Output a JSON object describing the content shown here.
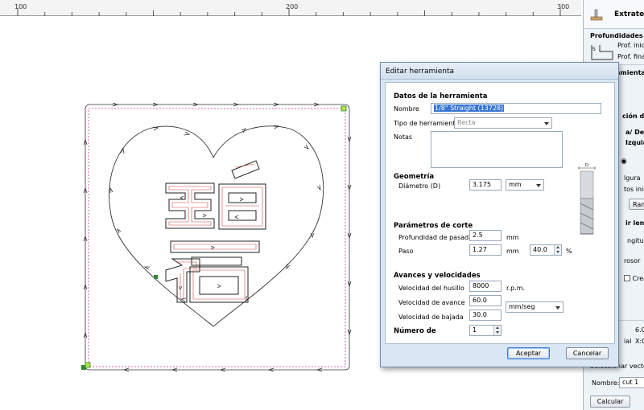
{
  "ruler": {
    "ticks": [
      "100",
      "200",
      "300"
    ]
  },
  "right_panel": {
    "title": "Extrategi",
    "depths_heading": "Profundidades de",
    "start_depth": "Prof. inicio",
    "final_depth": "Prof. final",
    "tool_label": "Herramienta:",
    "section_d": "ción d",
    "side_dir": "a/ Der",
    "left_dir": "Izquie",
    "safe_height": "lgura",
    "start_points": "tos inici",
    "ramp_button": "Ram",
    "length_label": "ir leng",
    "length_value": "ngitu",
    "thickness": "rosor",
    "create_check": "Crea",
    "val_a": "6.0",
    "val_b_label": "ial",
    "val_b": "X:0",
    "vectors_label": "Seleccionar vectore",
    "name_label": "Nombre:",
    "name_value": "cut 1",
    "calc_button": "Calcular"
  },
  "dialog": {
    "title": "Editar herramienta",
    "section_tool_data": "Datos de la herramienta",
    "name_label": "Nombre",
    "name_value": "1/8\" Straight (13728)",
    "tool_type_label": "Tipo de herramienta",
    "tool_type_value": "Recta",
    "notes_label": "Notas",
    "notes_value": "",
    "section_geometry": "Geometría",
    "diameter_label": "Diámetro (D)",
    "diameter_value": "3.175",
    "units_value": "mm",
    "section_cut": "Parámetros de corte",
    "pass_depth_label": "Profundidad de pasada",
    "pass_depth_value": "2.5",
    "pass_depth_unit": "mm",
    "stepover_label": "Paso",
    "stepover_value": "1.27",
    "stepover_unit": "mm",
    "stepover_pct_value": "40.0",
    "stepover_pct_unit": "%",
    "section_feeds": "Avances y velocidades",
    "spindle_label": "Velocidad del husillo",
    "spindle_value": "8000",
    "spindle_unit": "r.p.m.",
    "feed_label": "Velocidad de avance",
    "feed_value": "60.0",
    "plunge_label": "Velocidad de bajada",
    "plunge_value": "30.0",
    "rate_unit": "mm/seg",
    "tool_number_label": "Número de",
    "tool_number_value": "1",
    "ok_button": "Aceptar",
    "cancel_button": "Cancelar"
  },
  "colors": {
    "dialog_bg": "#d9e6f3",
    "selection": "#3874d2",
    "boundary": "#d0339a",
    "toolpath": "#d04545",
    "marker_green": "#2f8a2f"
  }
}
